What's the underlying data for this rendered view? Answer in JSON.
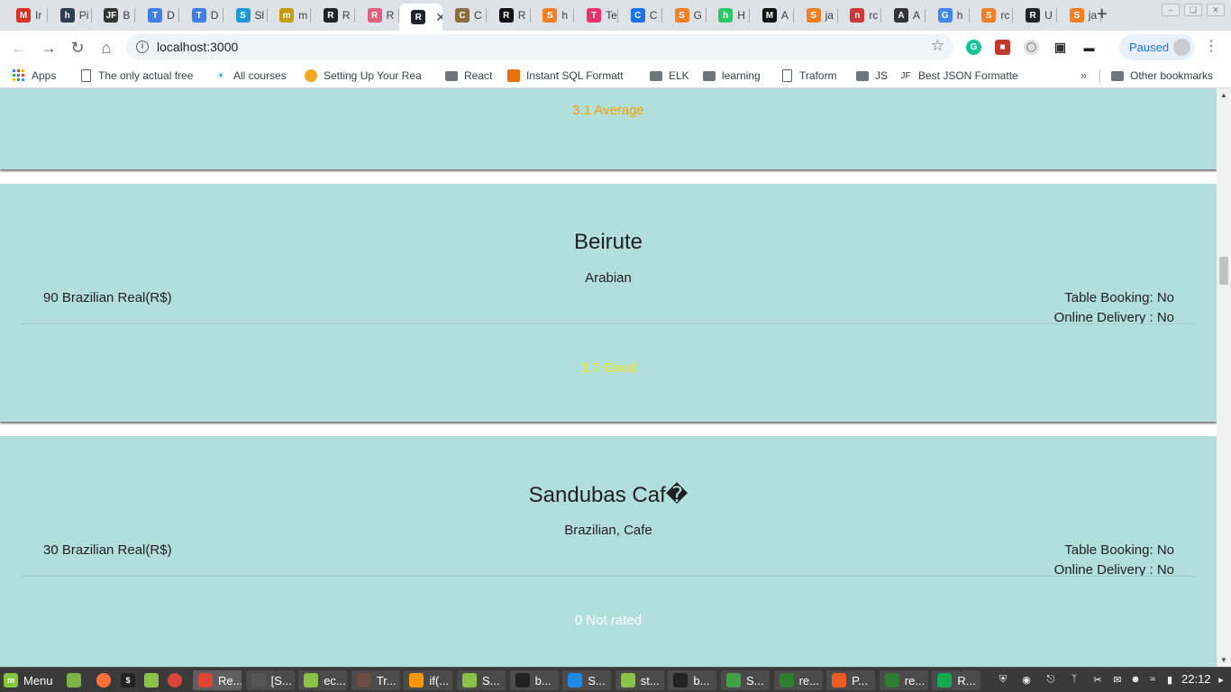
{
  "browser": {
    "tabs": [
      {
        "label": "Ir",
        "icon": "gmail-icon",
        "color": "#d93025",
        "glyph": "M"
      },
      {
        "label": "Pi",
        "icon": "hashnode-icon",
        "color": "#2c3e50",
        "glyph": "h"
      },
      {
        "label": "B",
        "icon": "jsonformatter-icon",
        "color": "#333333",
        "glyph": "JF"
      },
      {
        "label": "D",
        "icon": "typora-icon",
        "color": "#3f7ee8",
        "glyph": "T"
      },
      {
        "label": "D",
        "icon": "typora-icon",
        "color": "#3f7ee8",
        "glyph": "T"
      },
      {
        "label": "Sl",
        "icon": "graduation-cap-icon",
        "color": "#1c9ad6",
        "glyph": "S"
      },
      {
        "label": "m",
        "icon": "medium-like-icon",
        "color": "#c59b0e",
        "glyph": "m"
      },
      {
        "label": "R",
        "icon": "react-icon",
        "color": "#20232a",
        "glyph": "R"
      },
      {
        "label": "R",
        "icon": "react-pink-icon",
        "color": "#e0607e",
        "glyph": "R"
      },
      {
        "label": "",
        "icon": "react-icon",
        "color": "#20232a",
        "glyph": "R",
        "active": true
      },
      {
        "label": "C",
        "icon": "github-icon",
        "color": "#8a6d3b",
        "glyph": "C"
      },
      {
        "label": "R",
        "icon": "codepen-icon",
        "color": "#111111",
        "glyph": "R"
      },
      {
        "label": "h",
        "icon": "stackoverflow-icon",
        "color": "#f48024",
        "glyph": "S"
      },
      {
        "label": "Te",
        "icon": "toptal-icon",
        "color": "#e8336f",
        "glyph": "T"
      },
      {
        "label": "C",
        "icon": "circle-c-icon",
        "color": "#1a73e8",
        "glyph": "C"
      },
      {
        "label": "G",
        "icon": "stackoverflow-icon",
        "color": "#f48024",
        "glyph": "S"
      },
      {
        "label": "H",
        "icon": "hackerrank-icon",
        "color": "#2ec866",
        "glyph": "h"
      },
      {
        "label": "A",
        "icon": "medium-icon",
        "color": "#111111",
        "glyph": "M"
      },
      {
        "label": "ja",
        "icon": "stackoverflow-icon",
        "color": "#f48024",
        "glyph": "S"
      },
      {
        "label": "rc",
        "icon": "npm-icon",
        "color": "#cb3837",
        "glyph": "n"
      },
      {
        "label": "A",
        "icon": "unknown-icon",
        "color": "#333333",
        "glyph": "A"
      },
      {
        "label": "h",
        "icon": "google-icon",
        "color": "#4285f4",
        "glyph": "G"
      },
      {
        "label": "rc",
        "icon": "stackoverflow-icon",
        "color": "#f48024",
        "glyph": "S"
      },
      {
        "label": "U",
        "icon": "react-icon",
        "color": "#20232a",
        "glyph": "R"
      },
      {
        "label": "ja",
        "icon": "stackoverflow-icon",
        "color": "#f48024",
        "glyph": "S"
      }
    ],
    "url": "localhost:3000",
    "profile_status": "Paused",
    "bookmarks": [
      {
        "label": "Apps",
        "icon": "apps-grid-icon"
      },
      {
        "label": "The only actual free",
        "icon": "page-icon"
      },
      {
        "label": "All courses",
        "icon": "bulb-icon"
      },
      {
        "label": "Setting Up Your Rea",
        "icon": "orange-icon"
      },
      {
        "label": "React",
        "icon": "folder-icon"
      },
      {
        "label": "Instant SQL Formatt",
        "icon": "sql-icon"
      },
      {
        "label": "ELK",
        "icon": "folder-icon"
      },
      {
        "label": "learning",
        "icon": "folder-icon"
      },
      {
        "label": "Traform",
        "icon": "page-icon"
      },
      {
        "label": "JS",
        "icon": "folder-icon"
      },
      {
        "label": "Best JSON Formatte",
        "icon": "jsonformatter-icon"
      }
    ],
    "other_bookmarks": "Other bookmarks"
  },
  "restaurants": [
    {
      "name": "",
      "cuisine": "",
      "cost": "",
      "table_booking": "",
      "online_delivery": "",
      "rating": "3.1 Average",
      "rating_color": "#f4a300"
    },
    {
      "name": "Beirute",
      "cuisine": "Arabian",
      "cost": "90 Brazilian Real(R$)",
      "table_booking": "Table Booking: No",
      "online_delivery": "Online Delivery : No",
      "rating": "3.7 Good",
      "rating_color": "#eded1a"
    },
    {
      "name": "Sandubas Caf�",
      "cuisine": "Brazilian, Cafe",
      "cost": "30 Brazilian Real(R$)",
      "table_booking": "Table Booking: No",
      "online_delivery": "Online Delivery : No",
      "rating": "0 Not rated",
      "rating_color": "#ffffff"
    }
  ],
  "taskbar": {
    "menu_label": "Menu",
    "windows": [
      {
        "label": "Re...",
        "icon": "chrome-icon",
        "current": true
      },
      {
        "label": "[S...",
        "icon": "settings-icon"
      },
      {
        "label": "ec...",
        "icon": "folder-icon"
      },
      {
        "label": "Tr...",
        "icon": "gear-icon"
      },
      {
        "label": "if(...",
        "icon": "sublime-icon"
      },
      {
        "label": "S...",
        "icon": "folder-icon"
      },
      {
        "label": "b...",
        "icon": "terminal-icon"
      },
      {
        "label": "S...",
        "icon": "vscode-icon"
      },
      {
        "label": "st...",
        "icon": "folder-icon"
      },
      {
        "label": "b...",
        "icon": "terminal-icon"
      },
      {
        "label": "S...",
        "icon": "spreadsheet-icon"
      },
      {
        "label": "re...",
        "icon": "calc-icon"
      },
      {
        "label": "P...",
        "icon": "postman-icon"
      },
      {
        "label": "re...",
        "icon": "calc-icon"
      },
      {
        "label": "R...",
        "icon": "robo3t-icon"
      }
    ],
    "clock": "22:12"
  }
}
